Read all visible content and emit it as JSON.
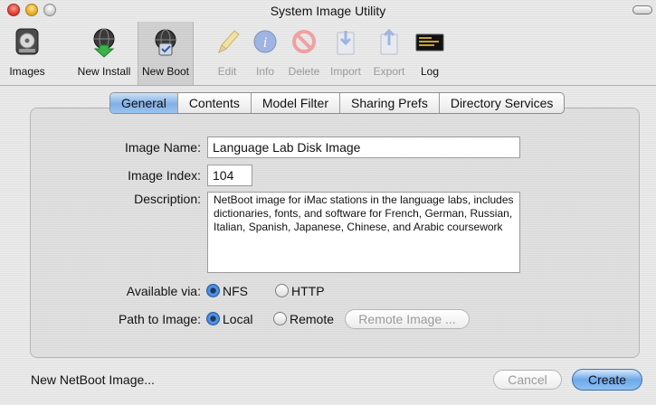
{
  "window": {
    "title": "System Image Utility"
  },
  "toolbar": {
    "items": [
      {
        "label": "Images",
        "icon": "disk-image-icon",
        "enabled": true
      },
      {
        "label": "New Install",
        "icon": "globe-download-icon",
        "enabled": true
      },
      {
        "label": "New Boot",
        "icon": "boot-globe-icon",
        "enabled": true,
        "selected": true
      },
      {
        "label": "Edit",
        "icon": "pencil-icon",
        "enabled": false
      },
      {
        "label": "Info",
        "icon": "info-icon",
        "enabled": false
      },
      {
        "label": "Delete",
        "icon": "delete-icon",
        "enabled": false
      },
      {
        "label": "Import",
        "icon": "import-icon",
        "enabled": false
      },
      {
        "label": "Export",
        "icon": "export-icon",
        "enabled": false
      },
      {
        "label": "Log",
        "icon": "console-log-icon",
        "enabled": true
      }
    ]
  },
  "tabs": [
    {
      "label": "General",
      "active": true
    },
    {
      "label": "Contents",
      "active": false
    },
    {
      "label": "Model Filter",
      "active": false
    },
    {
      "label": "Sharing Prefs",
      "active": false
    },
    {
      "label": "Directory Services",
      "active": false
    }
  ],
  "form": {
    "image_name_label": "Image Name:",
    "image_name_value": "Language Lab Disk Image",
    "image_index_label": "Image Index:",
    "image_index_value": "104",
    "description_label": "Description:",
    "description_value": "NetBoot image for iMac stations in the language labs, includes dictionaries, fonts, and software for French, German, Russian, Italian, Spanish, Japanese, Chinese, and Arabic coursework",
    "available_via_label": "Available via:",
    "available_via_options": [
      "NFS",
      "HTTP"
    ],
    "available_via_selected": "NFS",
    "path_label": "Path to Image:",
    "path_options": [
      "Local",
      "Remote"
    ],
    "path_selected": "Local",
    "remote_image_button": "Remote Image ..."
  },
  "footer": {
    "status_text": "New NetBoot Image...",
    "cancel_label": "Cancel",
    "create_label": "Create"
  },
  "colors": {
    "accent": "#6ea8ea",
    "window_bg": "#e6e6e6"
  }
}
